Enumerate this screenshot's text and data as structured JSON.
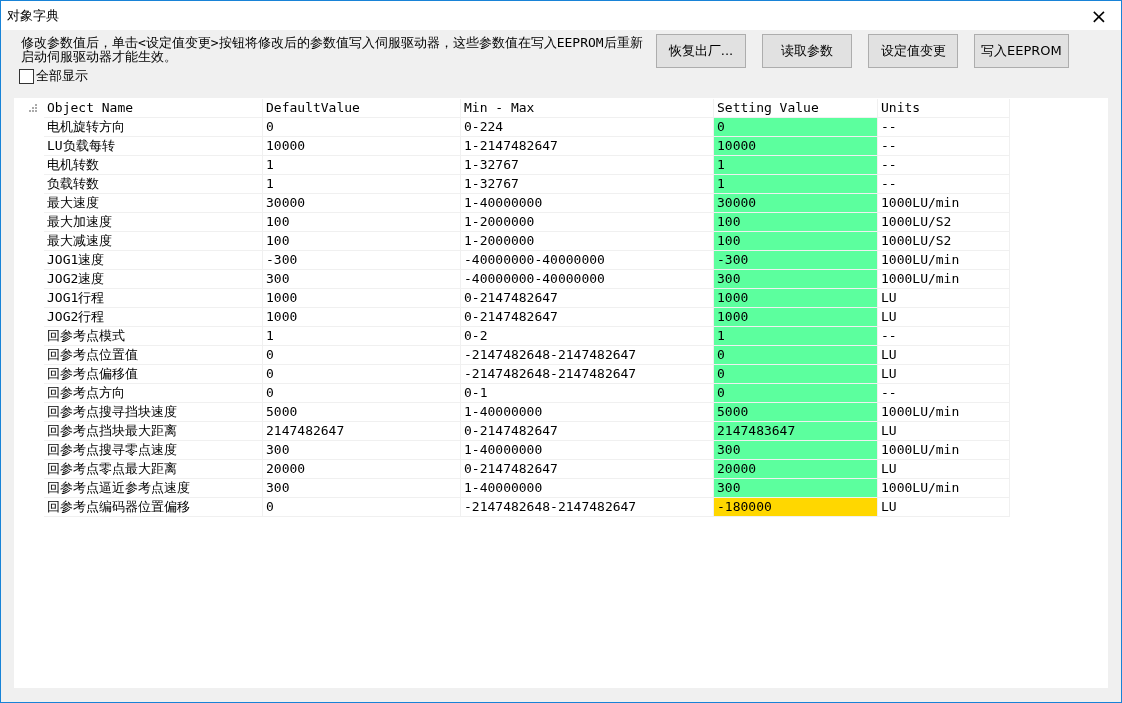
{
  "window": {
    "title": "对象字典",
    "close": "×"
  },
  "description": "修改参数值后，单击<设定值变更>按钮将修改后的参数值写入伺服驱动器，这些参数值在写入EEPROM后重新启动伺服驱动器才能生效。",
  "show_all": {
    "label": "全部显示",
    "checked": false
  },
  "buttons": [
    "恢复出厂...",
    "读取参数",
    "设定值变更",
    "写入EEPROM"
  ],
  "table": {
    "columns": [
      "Object Name",
      "DefaultValue",
      "Min - Max",
      "Setting Value",
      "Units"
    ],
    "rows": [
      {
        "cells": [
          "电机旋转方向",
          "0",
          "0-224",
          "0",
          "--"
        ],
        "color": "#5cff9e"
      },
      {
        "cells": [
          "LU负载每转",
          "10000",
          "1-2147482647",
          "10000",
          "--"
        ],
        "color": "#5cff9e"
      },
      {
        "cells": [
          "电机转数",
          "1",
          "1-32767",
          "1",
          "--"
        ],
        "color": "#5cff9e"
      },
      {
        "cells": [
          "负载转数",
          "1",
          "1-32767",
          "1",
          "--"
        ],
        "color": "#5cff9e"
      },
      {
        "cells": [
          "最大速度",
          "30000",
          "1-40000000",
          "30000",
          "1000LU/min"
        ],
        "color": "#5cff9e"
      },
      {
        "cells": [
          "最大加速度",
          "100",
          "1-2000000",
          "100",
          "1000LU/S2"
        ],
        "color": "#5cff9e"
      },
      {
        "cells": [
          "最大减速度",
          "100",
          "1-2000000",
          "100",
          "1000LU/S2"
        ],
        "color": "#5cff9e"
      },
      {
        "cells": [
          "JOG1速度",
          "-300",
          "-40000000-40000000",
          "-300",
          "1000LU/min"
        ],
        "color": "#5cff9e"
      },
      {
        "cells": [
          "JOG2速度",
          "300",
          "-40000000-40000000",
          "300",
          "1000LU/min"
        ],
        "color": "#5cff9e"
      },
      {
        "cells": [
          "JOG1行程",
          "1000",
          "0-2147482647",
          "1000",
          "LU"
        ],
        "color": "#5cff9e"
      },
      {
        "cells": [
          "JOG2行程",
          "1000",
          "0-2147482647",
          "1000",
          "LU"
        ],
        "color": "#5cff9e"
      },
      {
        "cells": [
          "回参考点模式",
          "1",
          "0-2",
          "1",
          "--"
        ],
        "color": "#5cff9e"
      },
      {
        "cells": [
          "回参考点位置值",
          "0",
          "-2147482648-2147482647",
          "0",
          "LU"
        ],
        "color": "#5cff9e"
      },
      {
        "cells": [
          "回参考点偏移值",
          "0",
          "-2147482648-2147482647",
          "0",
          "LU"
        ],
        "color": "#5cff9e"
      },
      {
        "cells": [
          "回参考点方向",
          "0",
          "0-1",
          "0",
          "--"
        ],
        "color": "#5cff9e"
      },
      {
        "cells": [
          "回参考点搜寻挡块速度",
          "5000",
          "1-40000000",
          "5000",
          "1000LU/min"
        ],
        "color": "#5cff9e"
      },
      {
        "cells": [
          "回参考点挡块最大距离",
          "2147482647",
          "0-2147482647",
          "2147483647",
          "LU"
        ],
        "color": "#5cff9e"
      },
      {
        "cells": [
          "回参考点搜寻零点速度",
          "300",
          "1-40000000",
          "300",
          "1000LU/min"
        ],
        "color": "#5cff9e"
      },
      {
        "cells": [
          "回参考点零点最大距离",
          "20000",
          "0-2147482647",
          "20000",
          "LU"
        ],
        "color": "#5cff9e"
      },
      {
        "cells": [
          "回参考点逼近参考点速度",
          "300",
          "1-40000000",
          "300",
          "1000LU/min"
        ],
        "color": "#5cff9e"
      },
      {
        "cells": [
          "回参考点编码器位置偏移",
          "0",
          "-2147482648-2147482647",
          "-180000",
          "LU"
        ],
        "color": "#ffd700"
      }
    ]
  }
}
